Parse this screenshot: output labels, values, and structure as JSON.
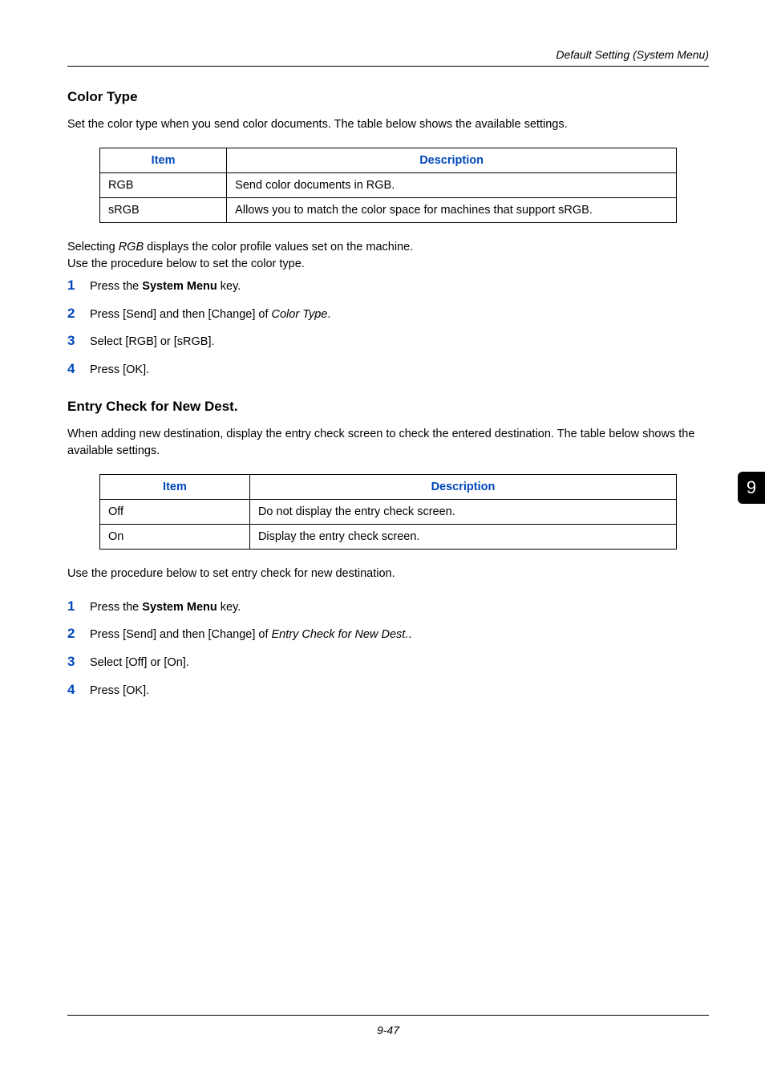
{
  "running_head": "Default Setting (System Menu)",
  "tab": "9",
  "page_number": "9-47",
  "section1": {
    "title": "Color Type",
    "intro": "Set the color type when you send color documents. The table below shows the available settings.",
    "table": {
      "head_item": "Item",
      "head_desc": "Description",
      "rows": [
        {
          "item": "RGB",
          "desc": "Send color documents in RGB."
        },
        {
          "item": "sRGB",
          "desc": "Allows you to match the color space for machines that support sRGB."
        }
      ]
    },
    "after_table_1_em": "RGB",
    "after_table_1_pre": "Selecting ",
    "after_table_1_post": " displays the color profile values set on the machine.",
    "after_table_2": "Use the procedure below to set the color type.",
    "steps": {
      "s1_pre": "Press the ",
      "s1_bold": "System Menu",
      "s1_post": " key.",
      "s2_pre": "Press [Send] and then [Change] of ",
      "s2_em": "Color Type",
      "s2_post": ".",
      "s3": "Select [RGB] or [sRGB].",
      "s4": "Press [OK]."
    }
  },
  "section2": {
    "title": "Entry Check for New Dest.",
    "intro": "When adding new destination, display the entry check screen to check the entered destination. The table below shows the available settings.",
    "table": {
      "head_item": "Item",
      "head_desc": "Description",
      "rows": [
        {
          "item": "Off",
          "desc": "Do not display the entry check screen."
        },
        {
          "item": "On",
          "desc": "Display the entry check screen."
        }
      ]
    },
    "after_table": "Use the procedure below to set entry check for new destination.",
    "steps": {
      "s1_pre": "Press the ",
      "s1_bold": "System Menu",
      "s1_post": " key.",
      "s2_pre": "Press [Send] and then [Change] of ",
      "s2_em": "Entry Check for New Dest.",
      "s2_post": ".",
      "s3": "Select [Off] or [On].",
      "s4": "Press [OK]."
    }
  }
}
